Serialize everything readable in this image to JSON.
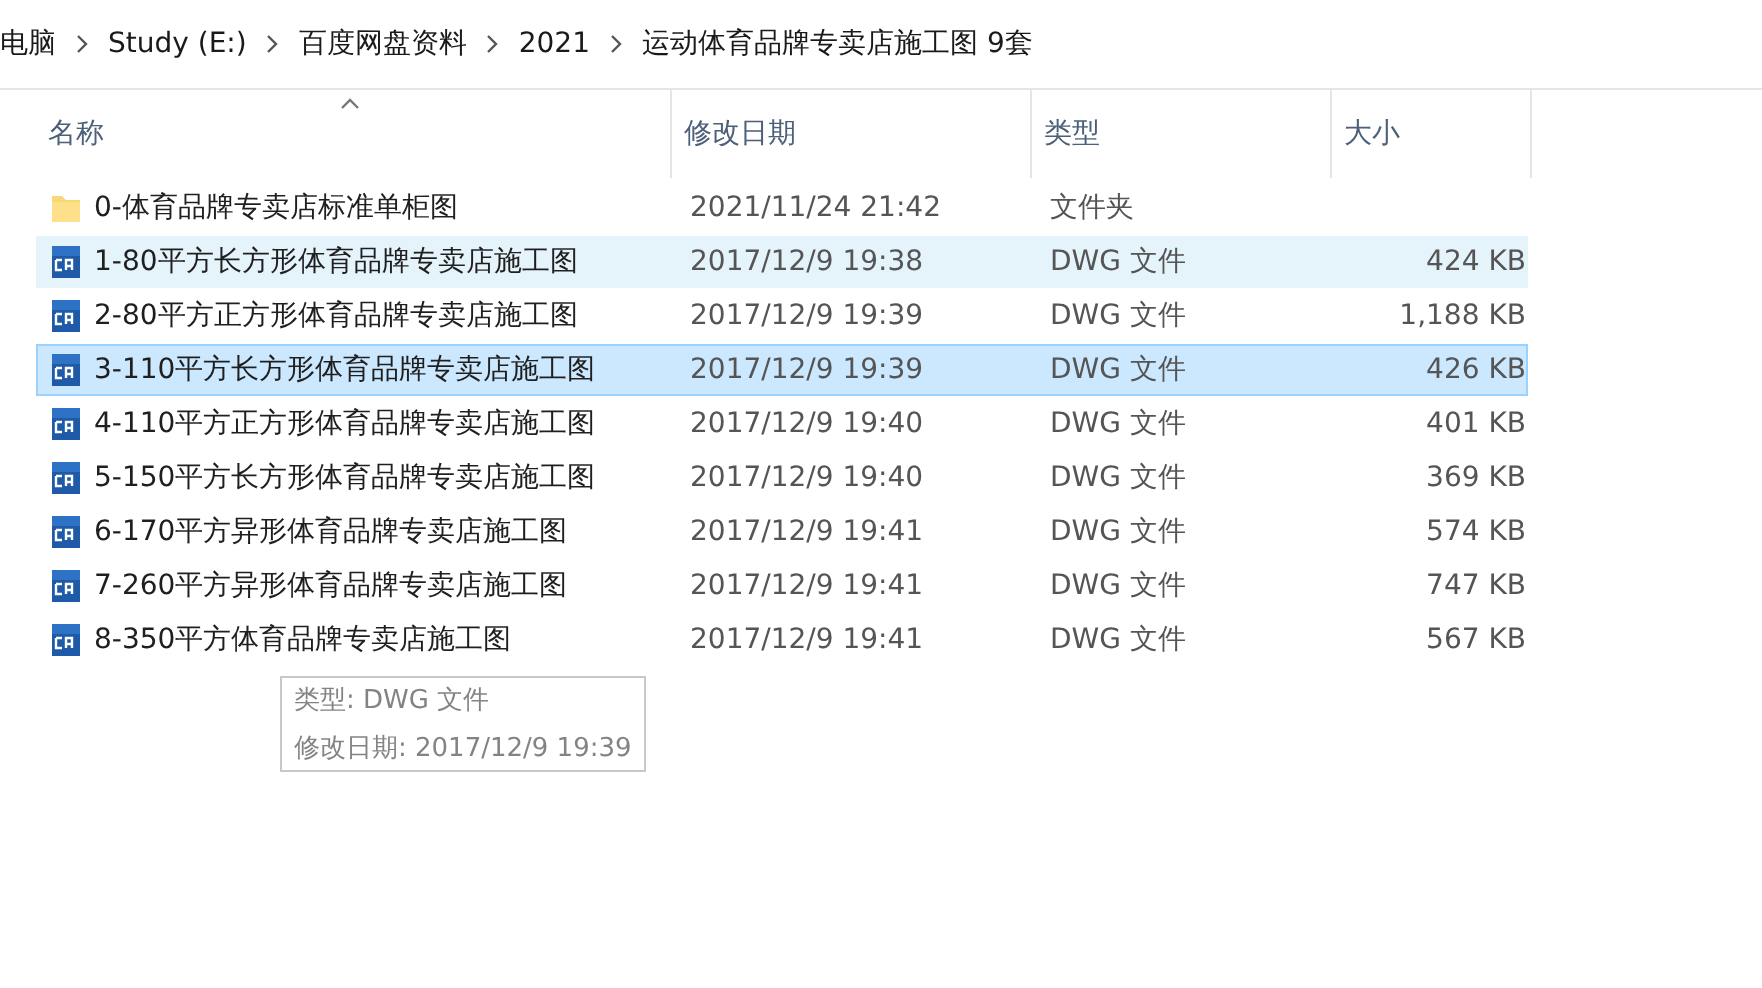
{
  "breadcrumb": [
    "电脑",
    "Study (E:)",
    "百度网盘资料",
    "2021",
    "运动体育品牌专卖店施工图 9套"
  ],
  "columns": [
    {
      "label": "名称",
      "sorted": true
    },
    {
      "label": "修改日期",
      "sorted": false
    },
    {
      "label": "类型",
      "sorted": false
    },
    {
      "label": "大小",
      "sorted": false
    }
  ],
  "rows": [
    {
      "kind": "folder",
      "name": "0-体育品牌专卖店标准单柜图",
      "date": "2021/11/24 21:42",
      "type": "文件夹",
      "size": "",
      "selected": false,
      "hovered": false
    },
    {
      "kind": "dwg",
      "name": "1-80平方长方形体育品牌专卖店施工图",
      "date": "2017/12/9 19:38",
      "type": "DWG 文件",
      "size": "424 KB",
      "selected": false,
      "hovered": true
    },
    {
      "kind": "dwg",
      "name": "2-80平方正方形体育品牌专卖店施工图",
      "date": "2017/12/9 19:39",
      "type": "DWG 文件",
      "size": "1,188 KB",
      "selected": false,
      "hovered": false
    },
    {
      "kind": "dwg",
      "name": "3-110平方长方形体育品牌专卖店施工图",
      "date": "2017/12/9 19:39",
      "type": "DWG 文件",
      "size": "426 KB",
      "selected": true,
      "hovered": false
    },
    {
      "kind": "dwg",
      "name": "4-110平方正方形体育品牌专卖店施工图",
      "date": "2017/12/9 19:40",
      "type": "DWG 文件",
      "size": "401 KB",
      "selected": false,
      "hovered": false
    },
    {
      "kind": "dwg",
      "name": "5-150平方长方形体育品牌专卖店施工图",
      "date": "2017/12/9 19:40",
      "type": "DWG 文件",
      "size": "369 KB",
      "selected": false,
      "hovered": false
    },
    {
      "kind": "dwg",
      "name": "6-170平方异形体育品牌专卖店施工图",
      "date": "2017/12/9 19:41",
      "type": "DWG 文件",
      "size": "574 KB",
      "selected": false,
      "hovered": false
    },
    {
      "kind": "dwg",
      "name": "7-260平方异形体育品牌专卖店施工图",
      "date": "2017/12/9 19:41",
      "type": "DWG 文件",
      "size": "747 KB",
      "selected": false,
      "hovered": false
    },
    {
      "kind": "dwg",
      "name": "8-350平方体育品牌专卖店施工图",
      "date": "2017/12/9 19:41",
      "type": "DWG 文件",
      "size": "567 KB",
      "selected": false,
      "hovered": false
    }
  ],
  "tooltip": [
    "类型: DWG 文件",
    "修改日期: 2017/12/9 19:39"
  ]
}
